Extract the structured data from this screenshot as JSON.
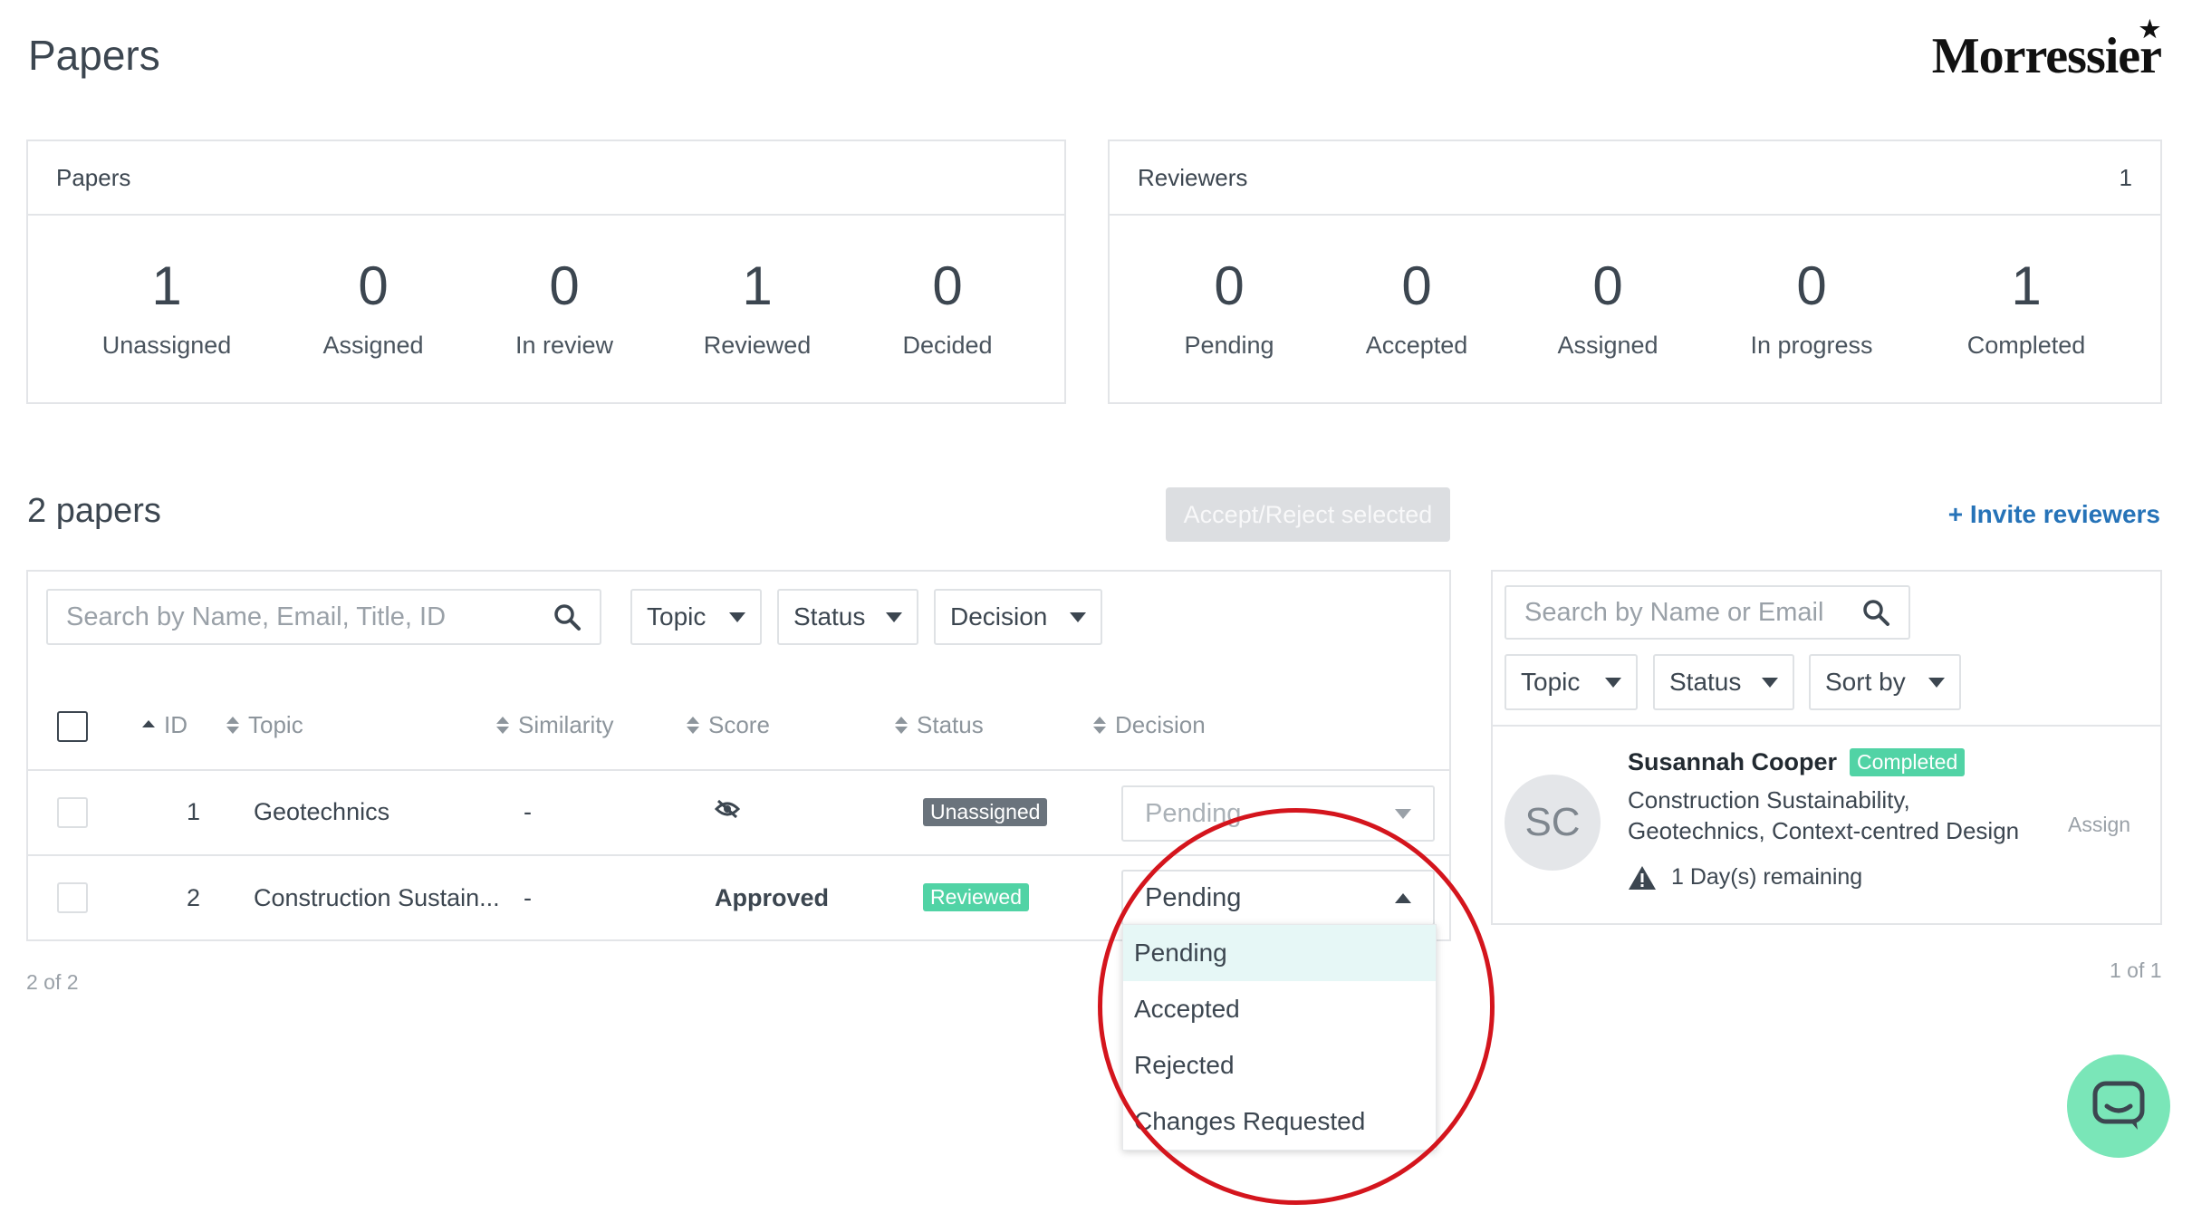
{
  "header": {
    "title": "Papers",
    "logo_text": "Morressier"
  },
  "papers_summary": {
    "title": "Papers",
    "stats": [
      {
        "value": "1",
        "label": "Unassigned"
      },
      {
        "value": "0",
        "label": "Assigned"
      },
      {
        "value": "0",
        "label": "In review"
      },
      {
        "value": "1",
        "label": "Reviewed"
      },
      {
        "value": "0",
        "label": "Decided"
      }
    ]
  },
  "reviewers_summary": {
    "title": "Reviewers",
    "count": "1",
    "stats": [
      {
        "value": "0",
        "label": "Pending"
      },
      {
        "value": "0",
        "label": "Accepted"
      },
      {
        "value": "0",
        "label": "Assigned"
      },
      {
        "value": "0",
        "label": "In progress"
      },
      {
        "value": "1",
        "label": "Completed"
      }
    ]
  },
  "papers_list": {
    "count_label": "2 papers",
    "accept_reject_label": "Accept/Reject selected",
    "search_placeholder": "Search by Name, Email, Title, ID",
    "filters": {
      "topic": "Topic",
      "status": "Status",
      "decision": "Decision"
    },
    "columns": {
      "id": "ID",
      "topic": "Topic",
      "similarity": "Similarity",
      "score": "Score",
      "status": "Status",
      "decision": "Decision"
    },
    "rows": [
      {
        "id": "1",
        "topic": "Geotechnics",
        "similarity": "-",
        "score": "",
        "status": "Unassigned",
        "decision": "Pending"
      },
      {
        "id": "2",
        "topic": "Construction Sustain...",
        "similarity": "-",
        "score": "Approved",
        "status": "Reviewed",
        "decision": "Pending"
      }
    ],
    "pagination": "2 of 2",
    "decision_options": [
      "Pending",
      "Accepted",
      "Rejected",
      "Changes Requested"
    ]
  },
  "reviewers_panel": {
    "invite_label": "+ Invite reviewers",
    "search_placeholder": "Search by Name or Email",
    "filters": {
      "topic": "Topic",
      "status": "Status",
      "sort": "Sort by"
    },
    "reviewer": {
      "initials": "SC",
      "name": "Susannah Cooper",
      "status": "Completed",
      "topics_line1": "Construction Sustainability,",
      "topics_line2": "Geotechnics, Context-centred Design",
      "remaining": "1 Day(s) remaining",
      "action": "Assign"
    },
    "pagination": "1 of 1"
  },
  "colors": {
    "accent_link": "#2673b8",
    "reviewed_green": "#51d3a5",
    "unassigned_grey": "#6a737c",
    "annotation_red": "#d4151d",
    "chat_green": "#7ae6b8"
  }
}
